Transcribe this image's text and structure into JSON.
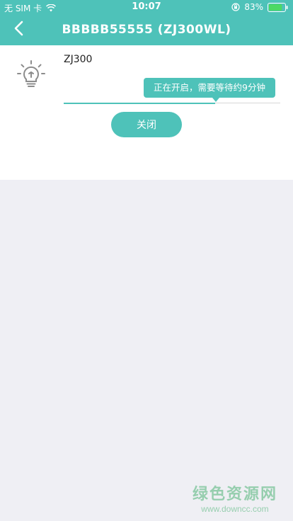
{
  "status_bar": {
    "carrier": "无 SIM 卡",
    "time": "10:07",
    "battery": "83%",
    "battery_level": 0.83
  },
  "nav": {
    "title": "BBBBB55555 (ZJ300WL)"
  },
  "device": {
    "name": "ZJ300",
    "tooltip": "正在开启，需要等待约9分钟",
    "progress": 0.7
  },
  "actions": {
    "close_label": "关闭"
  },
  "watermark": {
    "title": "绿色资源网",
    "url": "www.downcc.com"
  },
  "colors": {
    "accent": "#4ec2b9",
    "background": "#efeff4"
  },
  "icons": {
    "back": "chevron-left-icon",
    "bulb": "lightbulb-icon",
    "wifi": "wifi-icon",
    "lock": "orientation-lock-icon",
    "battery": "battery-icon"
  }
}
